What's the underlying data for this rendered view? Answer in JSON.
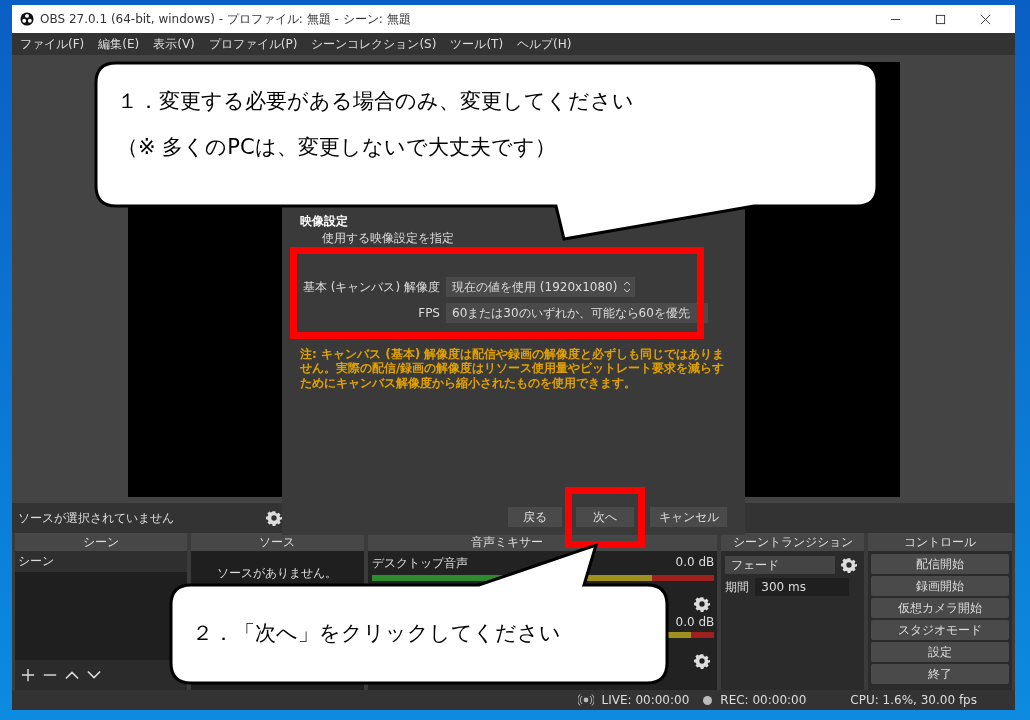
{
  "window": {
    "title": "OBS 27.0.1 (64-bit, windows) - プロファイル: 無題 - シーン: 無題"
  },
  "menu": [
    "ファイル(F)",
    "編集(E)",
    "表示(V)",
    "プロファイル(P)",
    "シーンコレクション(S)",
    "ツール(T)",
    "ヘルプ(H)"
  ],
  "dialog": {
    "title": "映像設定",
    "subtitle": "使用する映像設定を指定",
    "fields": [
      {
        "label": "基本 (キャンバス) 解像度",
        "value": "現在の値を使用 (1920x1080)"
      },
      {
        "label": "FPS",
        "value": "60または30のいずれか、可能なら60を優先"
      }
    ],
    "note": "注: キャンバス (基本) 解像度は配信や録画の解像度と必ずしも同じではありません。実際の配信/録画の解像度はリソース使用量やビットレート要求を減らすためにキャンバス解像度から縮小されたものを使用できます。",
    "buttons": [
      "戻る",
      "次へ",
      "キャンセル"
    ]
  },
  "source_bar": {
    "text": "ソースが選択されていません"
  },
  "scenes": {
    "title": "シーン",
    "items": [
      {
        "label": "シーン",
        "selected": true
      }
    ]
  },
  "sources": {
    "title": "ソース",
    "empty_text": "ソースがありません。"
  },
  "mixer": {
    "title": "音声ミキサー",
    "channels": [
      {
        "name": "デスクトップ音声",
        "reading": "0.0 dB"
      },
      {
        "reading": "0.0 dB"
      }
    ]
  },
  "transitions": {
    "title": "シーントランジション",
    "transition": "フェード",
    "duration_label": "期間",
    "duration": "300 ms"
  },
  "controls": {
    "title": "コントロール",
    "buttons": [
      "配信開始",
      "録画開始",
      "仮想カメラ開始",
      "スタジオモード",
      "設定",
      "終了"
    ]
  },
  "status_bar": {
    "live": "LIVE: 00:00:00",
    "rec": "REC: 00:00:00",
    "cpu": "CPU: 1.6%, 30.00 fps"
  },
  "callouts": [
    {
      "lines": [
        "１．変更する必要がある場合のみ、変更してください",
        "（※ 多くのPCは、変更しないで大丈夫です）"
      ]
    },
    {
      "lines": [
        "２．「次へ」をクリックしてください"
      ]
    }
  ]
}
